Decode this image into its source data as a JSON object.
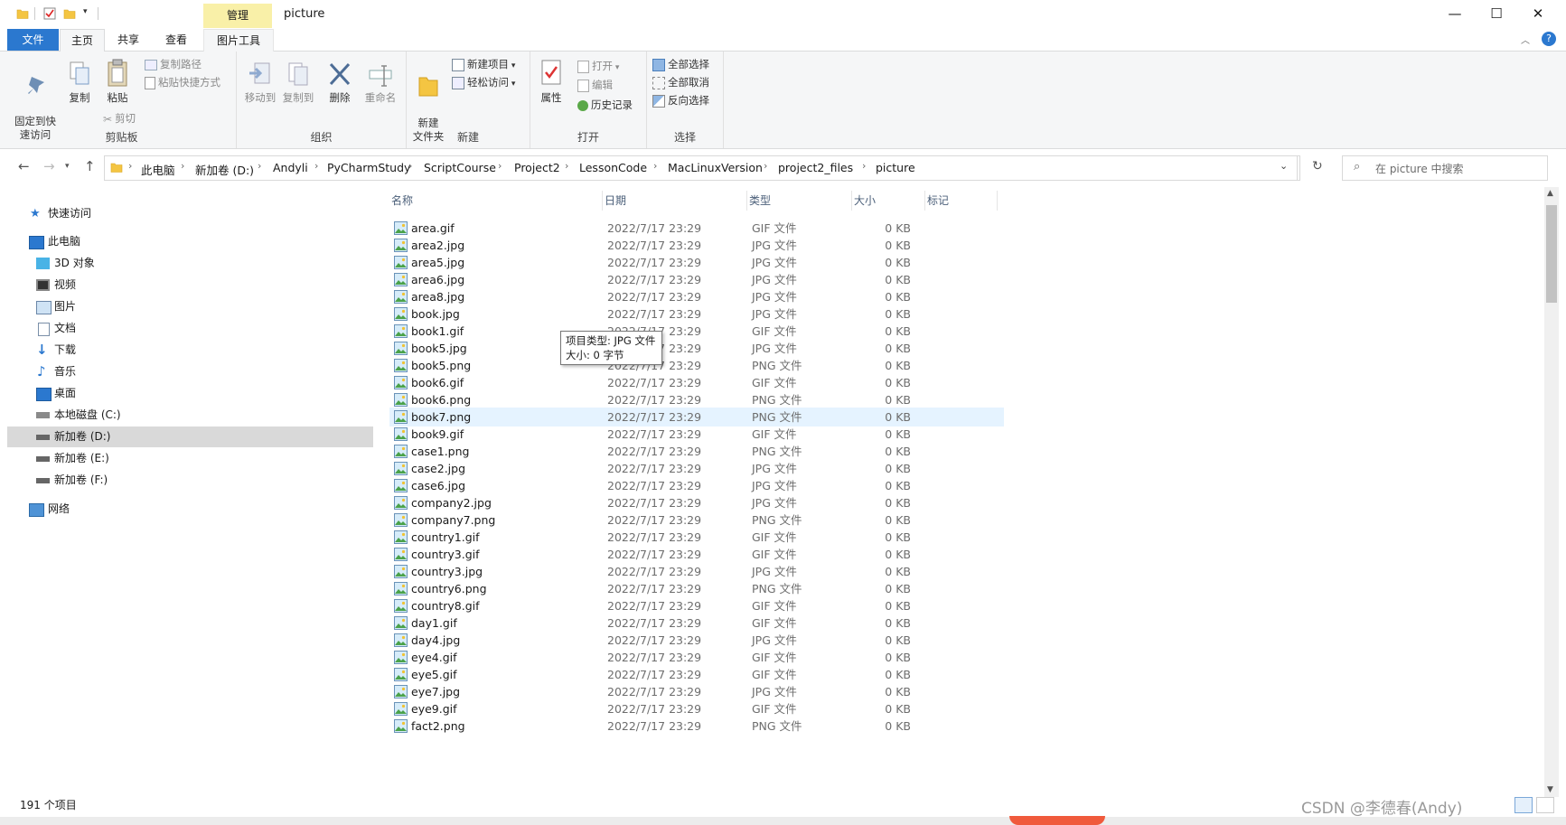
{
  "title_bar": {
    "manage_tab": "管理",
    "window_title": "picture",
    "controls": {
      "minimize": "—",
      "maximize": "☐",
      "close": "✕"
    }
  },
  "ribbon_tabs": {
    "file": "文件",
    "home": "主页",
    "share": "共享",
    "view": "查看",
    "picture_tools": "图片工具"
  },
  "ribbon": {
    "clipboard": {
      "label": "剪贴板",
      "pin": "固定到快\n速访问",
      "copy": "复制",
      "paste": "粘贴",
      "copy_path": "复制路径",
      "paste_shortcut": "粘贴快捷方式",
      "cut": "剪切"
    },
    "organize": {
      "label": "组织",
      "move_to": "移动到",
      "copy_to": "复制到",
      "delete": "删除",
      "rename": "重命名"
    },
    "new": {
      "label": "新建",
      "new_folder": "新建\n文件夹",
      "new_item": "新建项目",
      "easy_access": "轻松访问"
    },
    "open": {
      "label": "打开",
      "properties": "属性",
      "open": "打开",
      "edit": "编辑",
      "history": "历史记录"
    },
    "select": {
      "label": "选择",
      "select_all": "全部选择",
      "select_none": "全部取消",
      "invert": "反向选择"
    }
  },
  "address_bar": {
    "crumbs": [
      "此电脑",
      "新加卷 (D:)",
      "Andyli",
      "PyCharmStudy",
      "ScriptCourse",
      "Project2",
      "LessonCode",
      "MacLinuxVersion",
      "project2_files",
      "picture"
    ],
    "search_placeholder": "在 picture 中搜索"
  },
  "nav_pane": {
    "items": [
      {
        "label": "快速访问",
        "icon": "star-icon"
      },
      {
        "label": "此电脑",
        "icon": "computer-icon"
      },
      {
        "label": "3D 对象",
        "icon": "cube-icon"
      },
      {
        "label": "视频",
        "icon": "video-icon"
      },
      {
        "label": "图片",
        "icon": "pictures-icon"
      },
      {
        "label": "文档",
        "icon": "document-icon"
      },
      {
        "label": "下载",
        "icon": "download-icon"
      },
      {
        "label": "音乐",
        "icon": "music-icon"
      },
      {
        "label": "桌面",
        "icon": "desktop-icon"
      },
      {
        "label": "本地磁盘 (C:)",
        "icon": "drive-c-icon"
      },
      {
        "label": "新加卷 (D:)",
        "icon": "drive-icon"
      },
      {
        "label": "新加卷 (E:)",
        "icon": "drive-icon"
      },
      {
        "label": "新加卷 (F:)",
        "icon": "drive-icon"
      },
      {
        "label": "网络",
        "icon": "network-icon"
      }
    ]
  },
  "columns": {
    "name": "名称",
    "date": "日期",
    "type": "类型",
    "size": "大小",
    "tags": "标记"
  },
  "files": [
    {
      "name": "area.gif",
      "date": "2022/7/17 23:29",
      "type": "GIF 文件",
      "size": "0 KB"
    },
    {
      "name": "area2.jpg",
      "date": "2022/7/17 23:29",
      "type": "JPG 文件",
      "size": "0 KB"
    },
    {
      "name": "area5.jpg",
      "date": "2022/7/17 23:29",
      "type": "JPG 文件",
      "size": "0 KB"
    },
    {
      "name": "area6.jpg",
      "date": "2022/7/17 23:29",
      "type": "JPG 文件",
      "size": "0 KB"
    },
    {
      "name": "area8.jpg",
      "date": "2022/7/17 23:29",
      "type": "JPG 文件",
      "size": "0 KB"
    },
    {
      "name": "book.jpg",
      "date": "2022/7/17 23:29",
      "type": "JPG 文件",
      "size": "0 KB"
    },
    {
      "name": "book1.gif",
      "date": "2022/7/17 23:29",
      "type": "GIF 文件",
      "size": "0 KB"
    },
    {
      "name": "book5.jpg",
      "date": "2022/7/17 23:29",
      "type": "JPG 文件",
      "size": "0 KB"
    },
    {
      "name": "book5.png",
      "date": "2022/7/17 23:29",
      "type": "PNG 文件",
      "size": "0 KB"
    },
    {
      "name": "book6.gif",
      "date": "2022/7/17 23:29",
      "type": "GIF 文件",
      "size": "0 KB"
    },
    {
      "name": "book6.png",
      "date": "2022/7/17 23:29",
      "type": "PNG 文件",
      "size": "0 KB"
    },
    {
      "name": "book7.png",
      "date": "2022/7/17 23:29",
      "type": "PNG 文件",
      "size": "0 KB"
    },
    {
      "name": "book9.gif",
      "date": "2022/7/17 23:29",
      "type": "GIF 文件",
      "size": "0 KB"
    },
    {
      "name": "case1.png",
      "date": "2022/7/17 23:29",
      "type": "PNG 文件",
      "size": "0 KB"
    },
    {
      "name": "case2.jpg",
      "date": "2022/7/17 23:29",
      "type": "JPG 文件",
      "size": "0 KB"
    },
    {
      "name": "case6.jpg",
      "date": "2022/7/17 23:29",
      "type": "JPG 文件",
      "size": "0 KB"
    },
    {
      "name": "company2.jpg",
      "date": "2022/7/17 23:29",
      "type": "JPG 文件",
      "size": "0 KB"
    },
    {
      "name": "company7.png",
      "date": "2022/7/17 23:29",
      "type": "PNG 文件",
      "size": "0 KB"
    },
    {
      "name": "country1.gif",
      "date": "2022/7/17 23:29",
      "type": "GIF 文件",
      "size": "0 KB"
    },
    {
      "name": "country3.gif",
      "date": "2022/7/17 23:29",
      "type": "GIF 文件",
      "size": "0 KB"
    },
    {
      "name": "country3.jpg",
      "date": "2022/7/17 23:29",
      "type": "JPG 文件",
      "size": "0 KB"
    },
    {
      "name": "country6.png",
      "date": "2022/7/17 23:29",
      "type": "PNG 文件",
      "size": "0 KB"
    },
    {
      "name": "country8.gif",
      "date": "2022/7/17 23:29",
      "type": "GIF 文件",
      "size": "0 KB"
    },
    {
      "name": "day1.gif",
      "date": "2022/7/17 23:29",
      "type": "GIF 文件",
      "size": "0 KB"
    },
    {
      "name": "day4.jpg",
      "date": "2022/7/17 23:29",
      "type": "JPG 文件",
      "size": "0 KB"
    },
    {
      "name": "eye4.gif",
      "date": "2022/7/17 23:29",
      "type": "GIF 文件",
      "size": "0 KB"
    },
    {
      "name": "eye5.gif",
      "date": "2022/7/17 23:29",
      "type": "GIF 文件",
      "size": "0 KB"
    },
    {
      "name": "eye7.jpg",
      "date": "2022/7/17 23:29",
      "type": "JPG 文件",
      "size": "0 KB"
    },
    {
      "name": "eye9.gif",
      "date": "2022/7/17 23:29",
      "type": "GIF 文件",
      "size": "0 KB"
    },
    {
      "name": "fact2.png",
      "date": "2022/7/17 23:29",
      "type": "PNG 文件",
      "size": "0 KB"
    }
  ],
  "tooltip": {
    "line1": "项目类型: JPG 文件",
    "line2": "大小: 0 字节"
  },
  "status": {
    "count": "191 个项目"
  },
  "watermark": "CSDN @李德春(Andy)",
  "colors": {
    "file_tab": "#2b78cf",
    "manage_tab": "#f9f0a8",
    "hover_row": "#e5f3ff",
    "selected_nav": "#d9d9d9"
  }
}
